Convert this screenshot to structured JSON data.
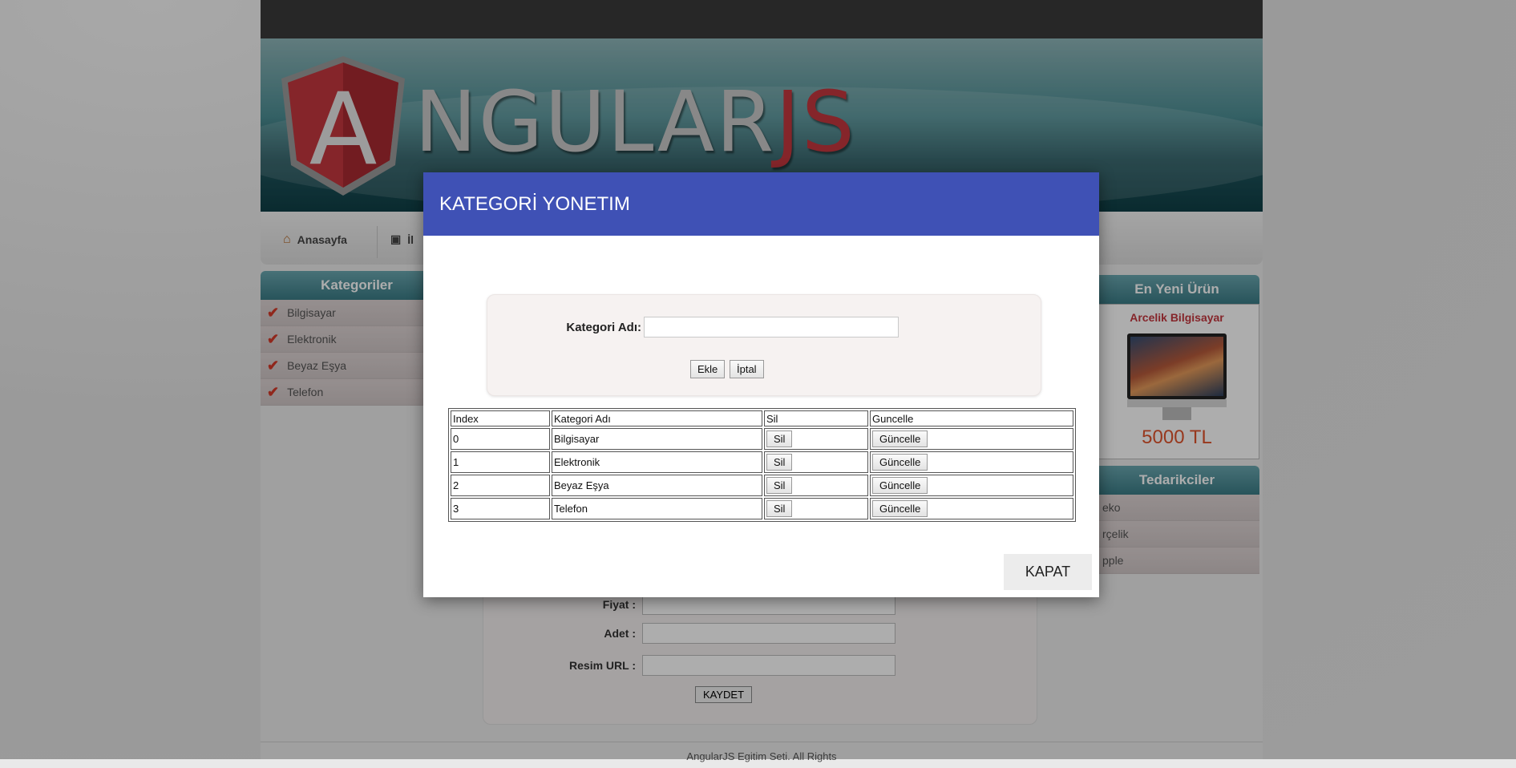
{
  "background": {
    "nav": {
      "home": "Anasayfa",
      "second": "İl"
    },
    "sidebar_left": {
      "title": "Kategoriler",
      "items": [
        {
          "label": "Bilgisayar"
        },
        {
          "label": "Elektronik"
        },
        {
          "label": "Beyaz Eşya"
        },
        {
          "label": "Telefon"
        }
      ]
    },
    "sidebar_right": {
      "newest_title": "En Yeni Ürün",
      "product_name": "Arcelik Bilgisayar",
      "product_price": "5000 TL",
      "suppliers_title": "Tedarikciler",
      "suppliers": [
        {
          "label": "eko"
        },
        {
          "label": "rçelik"
        },
        {
          "label": "pple"
        }
      ]
    },
    "form": {
      "price_label": "Fiyat :",
      "quantity_label": "Adet :",
      "image_url_label": "Resim URL :",
      "save_label": "KAYDET"
    },
    "footer": "AngularJS Egitim Seti. All Rights"
  },
  "logo": {
    "word": "NGULAR",
    "js": "JS",
    "letter": "A"
  },
  "modal": {
    "title": "KATEGORİ YONETIM",
    "category_label": "Kategori Adı:",
    "category_value": "",
    "add_label": "Ekle",
    "cancel_label": "İptal",
    "close_label": "KAPAT",
    "table": {
      "headers": [
        "Index",
        "Kategori Adı",
        "Sil",
        "Guncelle"
      ],
      "rows": [
        {
          "index": "0",
          "name": "Bilgisayar",
          "delete": "Sil",
          "update": "Güncelle"
        },
        {
          "index": "1",
          "name": "Elektronik",
          "delete": "Sil",
          "update": "Güncelle"
        },
        {
          "index": "2",
          "name": "Beyaz Eşya",
          "delete": "Sil",
          "update": "Güncelle"
        },
        {
          "index": "3",
          "name": "Telefon",
          "delete": "Sil",
          "update": "Güncelle"
        }
      ]
    }
  },
  "colors": {
    "modal_header": "#3f51b5",
    "accent_red": "#c4373e",
    "price": "#e0532c"
  }
}
